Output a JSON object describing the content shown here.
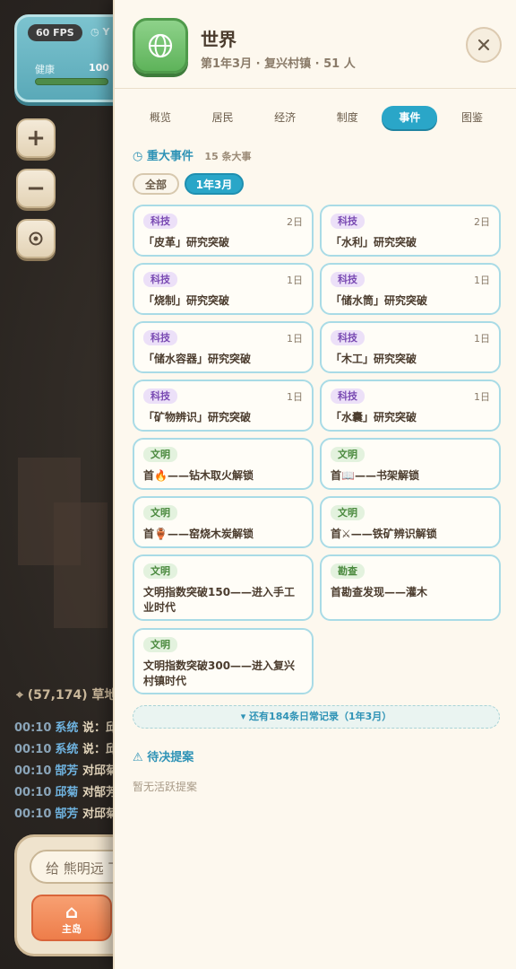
{
  "hud": {
    "fps": "60 FPS",
    "extra": "Y",
    "health_label": "健康",
    "health_value": "100"
  },
  "map_controls": {
    "zoom_in": "+",
    "zoom_out": "−"
  },
  "location": "(57,174) 草地",
  "chat_lines": [
    {
      "time": "00:10",
      "name": "系统",
      "text": "说：邱"
    },
    {
      "time": "00:10",
      "name": "系统",
      "text": "说：邱"
    },
    {
      "time": "00:10",
      "name": "郜芳",
      "text": "对邱菊"
    },
    {
      "time": "00:10",
      "name": "邱菊",
      "text": "对郜芳"
    },
    {
      "time": "00:10",
      "name": "郜芳",
      "text": "对邱菊"
    }
  ],
  "chat_input": {
    "placeholder": "给 熊明远 下"
  },
  "home_button": {
    "label": "主岛"
  },
  "panel": {
    "title": "世界",
    "subtitle": "第1年3月 · 复兴村镇 · 51 人",
    "tabs": [
      {
        "label": "概览",
        "active": false
      },
      {
        "label": "居民",
        "active": false
      },
      {
        "label": "经济",
        "active": false
      },
      {
        "label": "制度",
        "active": false
      },
      {
        "label": "事件",
        "active": true
      },
      {
        "label": "图鉴",
        "active": false
      }
    ],
    "events_header": {
      "title": "重大事件",
      "count": "15 条大事"
    },
    "filters": {
      "all": "全部",
      "month": "1年3月"
    },
    "events": [
      {
        "tag": "科技",
        "type": "tech",
        "day": "2日",
        "text": "「皮革」研究突破"
      },
      {
        "tag": "科技",
        "type": "tech",
        "day": "2日",
        "text": "「水利」研究突破"
      },
      {
        "tag": "科技",
        "type": "tech",
        "day": "1日",
        "text": "「烧制」研究突破"
      },
      {
        "tag": "科技",
        "type": "tech",
        "day": "1日",
        "text": "「储水筒」研究突破"
      },
      {
        "tag": "科技",
        "type": "tech",
        "day": "1日",
        "text": "「储水容器」研究突破"
      },
      {
        "tag": "科技",
        "type": "tech",
        "day": "1日",
        "text": "「木工」研究突破"
      },
      {
        "tag": "科技",
        "type": "tech",
        "day": "1日",
        "text": "「矿物辨识」研究突破"
      },
      {
        "tag": "科技",
        "type": "tech",
        "day": "1日",
        "text": "「水囊」研究突破"
      },
      {
        "tag": "文明",
        "type": "civ",
        "day": "",
        "text": "首🔥——钻木取火解锁"
      },
      {
        "tag": "文明",
        "type": "civ",
        "day": "",
        "text": "首📖——书架解锁"
      },
      {
        "tag": "文明",
        "type": "civ",
        "day": "",
        "text": "首🏺——窑烧木炭解锁"
      },
      {
        "tag": "文明",
        "type": "civ",
        "day": "",
        "text": "首⚔——铁矿辨识解锁"
      },
      {
        "tag": "文明",
        "type": "civ",
        "day": "",
        "text": "文明指数突破150——进入手工业时代"
      },
      {
        "tag": "勘查",
        "type": "civ",
        "day": "",
        "text": "首勘查发现——灌木"
      },
      {
        "tag": "文明",
        "type": "civ",
        "day": "",
        "text": "文明指数突破300——进入复兴村镇时代"
      }
    ],
    "more_records": "▾ 还有184条日常记录（1年3月）",
    "proposals_header": "待决提案",
    "proposals_empty": "暂无活跃提案"
  }
}
